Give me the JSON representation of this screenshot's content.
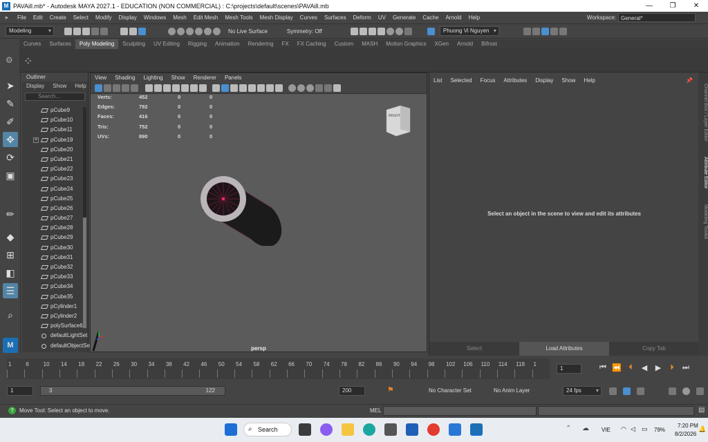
{
  "window": {
    "title": "PAVAill.mb* - Autodesk MAYA 2027.1 - EDUCATION (NON COMMERCIAL) : C:\\projects\\default\\scenes\\PAVAill.mb",
    "app_icon": "M",
    "controls": [
      "—",
      "❐",
      "✕"
    ]
  },
  "menubar": {
    "items": [
      "File",
      "Edit",
      "Create",
      "Select",
      "Modify",
      "Display",
      "Windows",
      "Mesh",
      "Edit Mesh",
      "Mesh Tools",
      "Mesh Display",
      "Curves",
      "Surfaces",
      "Deform",
      "UV",
      "Generate",
      "Cache",
      "Arnold",
      "Help"
    ],
    "workspace_label": "Workspace:",
    "workspace_value": "General*"
  },
  "statusline": {
    "menuset": "Modeling",
    "live_surface": "No Live Surface",
    "symmetry": "Symmetry: Off",
    "user": "Phuong Vi Nguyen"
  },
  "shelf": {
    "tabs": [
      "Curves",
      "Surfaces",
      "Poly Modeling",
      "Sculpting",
      "UV Editing",
      "Rigging",
      "Animation",
      "Rendering",
      "FX",
      "FX Caching",
      "Custom",
      "MASH",
      "Motion Graphics",
      "XGen",
      "Arnold",
      "Bifrost"
    ],
    "active_tab": "Poly Modeling"
  },
  "outliner": {
    "title": "Outliner",
    "menu": [
      "Display",
      "Show",
      "Help"
    ],
    "search_placeholder": "Search...",
    "items": [
      "pCube9",
      "pCube10",
      "pCube11",
      "pCube19",
      "pCube20",
      "pCube21",
      "pCube22",
      "pCube23",
      "pCube24",
      "pCube25",
      "pCube26",
      "pCube27",
      "pCube28",
      "pCube29",
      "pCube30",
      "pCube31",
      "pCube32",
      "pCube33",
      "pCube34",
      "pCube35",
      "pCylinder1",
      "pCylinder2",
      "polySurface6",
      "defaultLightSet",
      "defaultObjectSet"
    ]
  },
  "viewport": {
    "menu": [
      "View",
      "Shading",
      "Lighting",
      "Show",
      "Renderer",
      "Panels"
    ],
    "hud": [
      {
        "label": "Verts:",
        "a": "452",
        "b": "0",
        "c": "0"
      },
      {
        "label": "Edges:",
        "a": "792",
        "b": "0",
        "c": "0"
      },
      {
        "label": "Faces:",
        "a": "416",
        "b": "0",
        "c": "0"
      },
      {
        "label": "Tris:",
        "a": "752",
        "b": "0",
        "c": "0"
      },
      {
        "label": "UVs:",
        "a": "890",
        "b": "0",
        "c": "0"
      }
    ],
    "viewcube_label": "RIGHT",
    "camera": "persp"
  },
  "attribute_editor": {
    "menu": [
      "List",
      "Selected",
      "Focus",
      "Attributes",
      "Display",
      "Show",
      "Help"
    ],
    "message": "Select an object in the scene to view and edit its attributes",
    "buttons": [
      "Select",
      "Load Attributes",
      "Copy Tab"
    ]
  },
  "side_tabs": [
    "Channel Box / Layer Editor",
    "Attribute Editor",
    "Modeling Toolkit"
  ],
  "timeline": {
    "ticks": [
      "1",
      "6",
      "10",
      "14",
      "18",
      "22",
      "26",
      "30",
      "34",
      "38",
      "42",
      "46",
      "50",
      "54",
      "58",
      "62",
      "66",
      "70",
      "74",
      "78",
      "82",
      "86",
      "90",
      "94",
      "98",
      "102",
      "106",
      "110",
      "114",
      "118",
      "1"
    ],
    "current_frame": "1",
    "range_start": "1",
    "range_inner_start": "3",
    "range_inner_end": "122",
    "range_end": "200",
    "character_set": "No Character Set",
    "anim_layer": "No Anim Layer",
    "fps": "24 fps"
  },
  "helpline": {
    "text": "Move Tool: Select an object to move.",
    "mel_label": "MEL"
  },
  "taskbar": {
    "search": "Search",
    "lang": "VIE",
    "battery": "79%",
    "time": "7:20 PM",
    "date": "8/2/2026"
  }
}
